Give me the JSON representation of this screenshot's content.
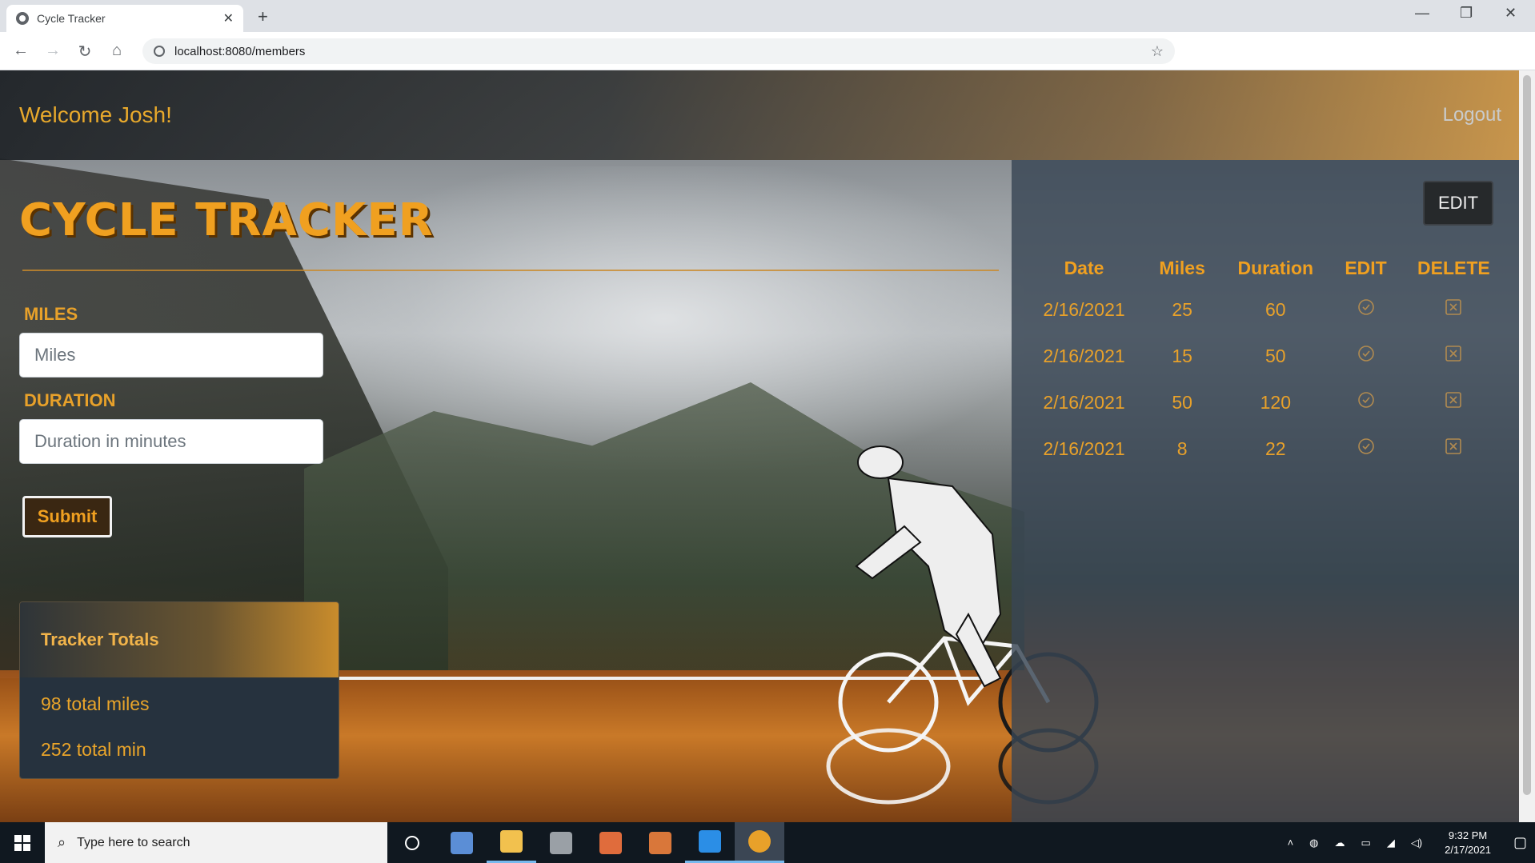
{
  "browser": {
    "tab_title": "Cycle Tracker",
    "url": "localhost:8080/members"
  },
  "header": {
    "welcome": "Welcome Josh!",
    "logout": "Logout"
  },
  "brand": "CYCLE TRACKER",
  "form": {
    "miles_label": "MILES",
    "miles_placeholder": "Miles",
    "duration_label": "DURATION",
    "duration_placeholder": "Duration in minutes",
    "submit_label": "Submit"
  },
  "totals": {
    "title": "Tracker Totals",
    "miles": "98 total miles",
    "minutes": "252 total min"
  },
  "panel": {
    "edit_button": "EDIT",
    "columns": [
      "Date",
      "Miles",
      "Duration",
      "EDIT",
      "DELETE"
    ],
    "rows": [
      {
        "date": "2/16/2021",
        "miles": "25",
        "duration": "60"
      },
      {
        "date": "2/16/2021",
        "miles": "15",
        "duration": "50"
      },
      {
        "date": "2/16/2021",
        "miles": "50",
        "duration": "120"
      },
      {
        "date": "2/16/2021",
        "miles": "8",
        "duration": "22"
      }
    ],
    "edit_icon": "check-circle-icon",
    "delete_icon": "x-square-icon"
  },
  "taskbar": {
    "search_placeholder": "Type here to search",
    "time": "9:32 PM",
    "date": "2/17/2021"
  },
  "colors": {
    "accent": "#f0a020",
    "panel": "#384654",
    "totals_body": "#26323e"
  }
}
